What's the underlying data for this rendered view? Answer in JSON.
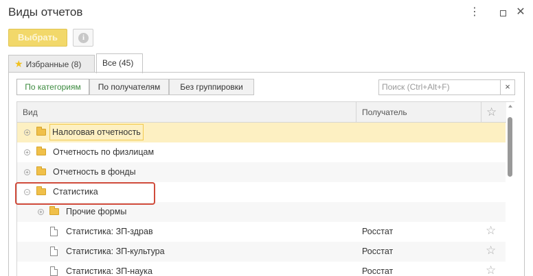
{
  "window": {
    "title": "Виды отчетов",
    "more_icon": "⋮",
    "close_icon": "✕"
  },
  "toolbar": {
    "select_label": "Выбрать",
    "info_icon": "i"
  },
  "tabs": [
    {
      "label": "Избранные (8)",
      "icon": "star-icon"
    },
    {
      "label": "Все (45)"
    }
  ],
  "grouping": {
    "by_category": "По категориям",
    "by_recipient": "По получателям",
    "no_grouping": "Без группировки"
  },
  "search": {
    "placeholder": "Поиск (Ctrl+Alt+F)",
    "clear_icon": "×"
  },
  "grid": {
    "columns": {
      "vid": "Вид",
      "recipient": "Получатель",
      "favorite": "☆"
    },
    "rows": [
      {
        "label": "Налоговая отчетность",
        "type": "folder",
        "expander": "+",
        "recipient": "",
        "star": ""
      },
      {
        "label": "Отчетность по физлицам",
        "type": "folder",
        "expander": "+",
        "recipient": "",
        "star": ""
      },
      {
        "label": "Отчетность в фонды",
        "type": "folder",
        "expander": "+",
        "recipient": "",
        "star": ""
      },
      {
        "label": "Статистика",
        "type": "folder",
        "expander": "−",
        "recipient": "",
        "star": ""
      },
      {
        "label": "Прочие формы",
        "type": "folder",
        "expander": "+",
        "recipient": "",
        "star": ""
      },
      {
        "label": "Статистика: ЗП-здрав",
        "type": "doc",
        "recipient": "Росстат",
        "star": "☆"
      },
      {
        "label": "Статистика: ЗП-культура",
        "type": "doc",
        "recipient": "Росстат",
        "star": "☆"
      },
      {
        "label": "Статистика: ЗП-наука",
        "type": "doc",
        "recipient": "Росстат",
        "star": "☆"
      }
    ]
  }
}
